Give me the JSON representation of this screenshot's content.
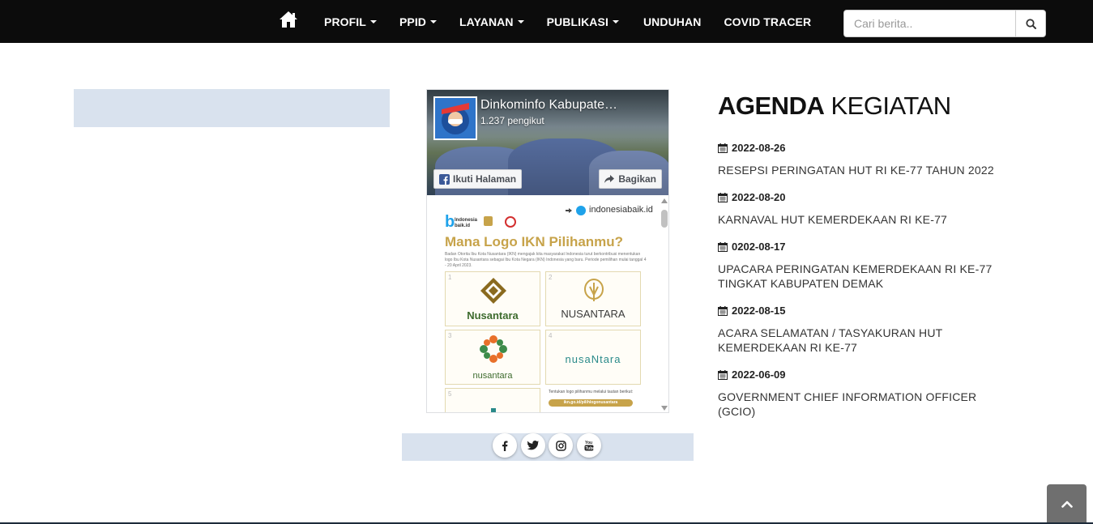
{
  "nav": {
    "home_icon": "home-icon",
    "items": [
      {
        "label": "PROFIL",
        "dropdown": true
      },
      {
        "label": "PPID",
        "dropdown": true
      },
      {
        "label": "LAYANAN",
        "dropdown": true
      },
      {
        "label": "PUBLIKASI",
        "dropdown": true
      },
      {
        "label": "UNDUHAN",
        "dropdown": false
      },
      {
        "label": "COVID TRACER",
        "dropdown": false
      }
    ],
    "background": "#0c0c0c"
  },
  "search": {
    "placeholder": "Cari berita..",
    "button_icon": "search-icon"
  },
  "facebook_widget": {
    "page_name": "Dinkominfo Kabupate…",
    "followers": "1.237 pengikut",
    "follow_label": "Ikuti Halaman",
    "share_label": "Bagikan",
    "post": {
      "source": "indonesiabaik.id",
      "brand": "Indonesia baik.id",
      "title": "Mana Logo IKN Pilihanmu?",
      "description": "Badan Otorita Ibu Kota Nusantara (IKN) mengajak kita masyarakat Indonesia turut berkontribusi menentukan logo Ibu Kota Nusantara sebagai Ibu Kota Negara (IKN) Indonesia yang baru. Periode pemilihan mulai tanggal 4 - 20 April 2023.",
      "options": [
        {
          "number": "1",
          "text": "Nusantara"
        },
        {
          "number": "2",
          "text": "NUSANTARA"
        },
        {
          "number": "3",
          "text": "nusantara"
        },
        {
          "number": "4",
          "text": "nusaNtara"
        },
        {
          "number": "5",
          "text": ""
        }
      ],
      "cta_text": "Tentukan logo pilihanmu melalui tautan berikut:",
      "cta_link": "ikn.go.id/pilihlogonusantara"
    }
  },
  "social": [
    {
      "icon": "facebook-icon"
    },
    {
      "icon": "twitter-icon"
    },
    {
      "icon": "instagram-icon"
    },
    {
      "icon": "youtube-icon"
    }
  ],
  "agenda": {
    "title_bold": "AGENDA",
    "title_light": "KEGIATAN",
    "items": [
      {
        "date": "2022-08-26",
        "title": "RESEPSI PERINGATAN HUT RI KE-77 TAHUN 2022"
      },
      {
        "date": "2022-08-20",
        "title": "KARNAVAL HUT KEMERDEKAAN RI KE-77"
      },
      {
        "date": "0202-08-17",
        "title": "UPACARA PERINGATAN KEMERDEKAAN RI KE-77 TINGKAT KABUPATEN DEMAK"
      },
      {
        "date": "2022-08-15",
        "title": "ACARA SELAMATAN / TASYAKURAN HUT KEMERDEKAAN RI KE-77"
      },
      {
        "date": "2022-06-09",
        "title": "GOVERNMENT CHIEF INFORMATION OFFICER (GCIO)"
      }
    ]
  },
  "colors": {
    "panel_bg": "#d9e2ee",
    "back_to_top": "#6f6f6f",
    "ikn_gold": "#c7a34a"
  }
}
